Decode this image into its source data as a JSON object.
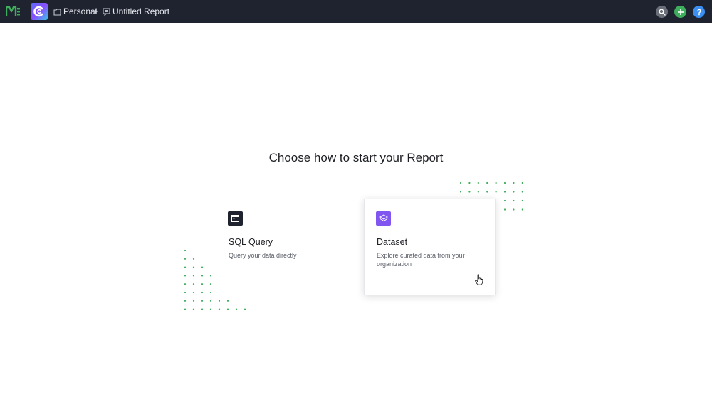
{
  "header": {
    "breadcrumb": {
      "collection": "Personal",
      "report": "Untitled Report"
    },
    "icons": {
      "brand": "m-logo-icon",
      "app": "app-logo-icon",
      "search": "search-icon",
      "add": "plus-icon",
      "help": "help-icon"
    },
    "colors": {
      "bar_bg": "#1f2330",
      "search_btn": "#6b6f7a",
      "add_btn": "#3fae5c",
      "help_btn": "#3b8ff0"
    }
  },
  "main": {
    "heading": "Choose how to start your Report",
    "options": [
      {
        "title": "SQL Query",
        "description": "Query your data directly",
        "icon": "terminal-icon",
        "icon_color": "#1f2330"
      },
      {
        "title": "Dataset",
        "description": "Explore curated data from your organization",
        "icon": "layers-icon",
        "icon_color": "#8055f0"
      }
    ],
    "accent_dot_color": "#3fae5c"
  }
}
